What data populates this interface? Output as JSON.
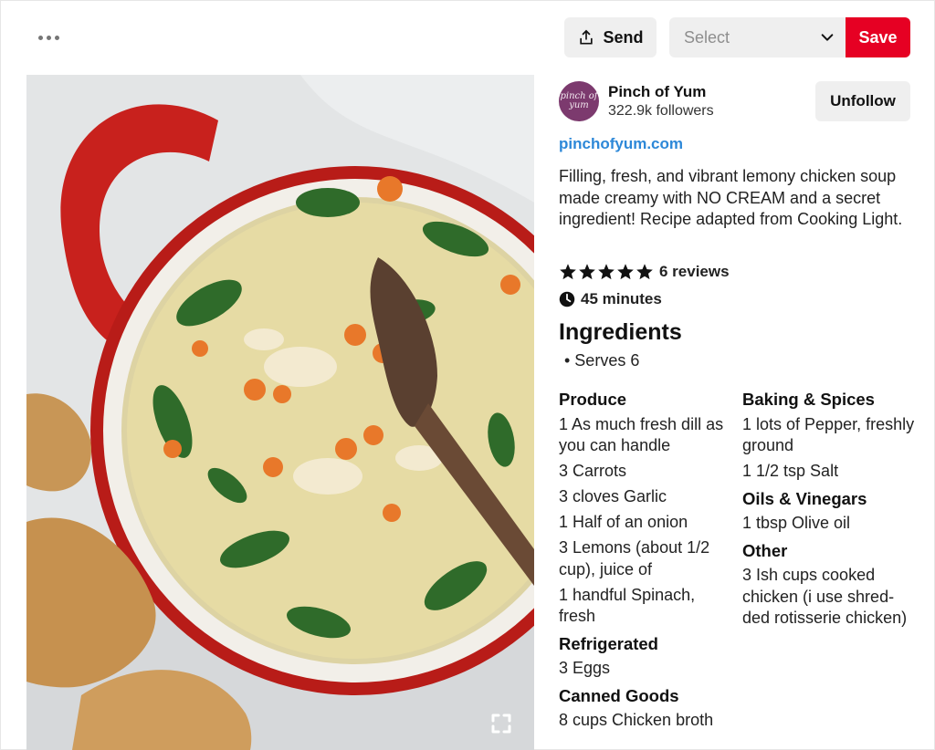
{
  "toolbar": {
    "more_icon": "more-dots-icon",
    "send_label": "Send",
    "send_icon": "share-upload-icon",
    "board_select": {
      "placeholder": "Select",
      "icon": "chevron-down-icon"
    },
    "save_label": "Save",
    "accent_color": "#e60023"
  },
  "creator": {
    "avatar_text_top": "pinch of",
    "avatar_text_bottom": "yum",
    "name": "Pinch of Yum",
    "followers": "322.9k followers",
    "unfollow_label": "Unfollow"
  },
  "pin": {
    "source_link": "pinchofyum.com",
    "description": "Filling, fresh, and vibrant lemony chicken soup made creamy with NO CREAM and a secret ingredient! Recipe adapted from Cooking Light.",
    "rating_stars": 5,
    "reviews": "6 reviews",
    "time": "45 minutes",
    "link_color": "#2d88d8"
  },
  "ingredients": {
    "title": "Ingredients",
    "serves": "• Serves 6",
    "left_column": [
      {
        "heading": "Produce",
        "items": [
          "1 As much fresh dill as you can handle",
          "3 Carrots",
          "3 cloves Garlic",
          "1 Half of an onion",
          "3 Lemons (about 1/2 cup), juice of",
          "1 handful Spinach, fresh"
        ]
      },
      {
        "heading": "Refrigerated",
        "items": [
          "3 Eggs"
        ]
      },
      {
        "heading": "Canned Goods",
        "items": [
          "8 cups Chicken broth"
        ]
      }
    ],
    "right_column": [
      {
        "heading": "Baking & Spices",
        "items": [
          "1 lots of Pepper, freshly ground",
          "1 1/2 tsp Salt"
        ]
      },
      {
        "heading": "Oils & Vinegars",
        "items": [
          "1 tbsp Olive oil"
        ]
      },
      {
        "heading": "Other",
        "items": [
          "3 Ish cups cooked chicken (i use shred-ded rotisserie chicken)"
        ]
      }
    ]
  },
  "image": {
    "expand_icon": "expand-fullscreen-icon"
  }
}
